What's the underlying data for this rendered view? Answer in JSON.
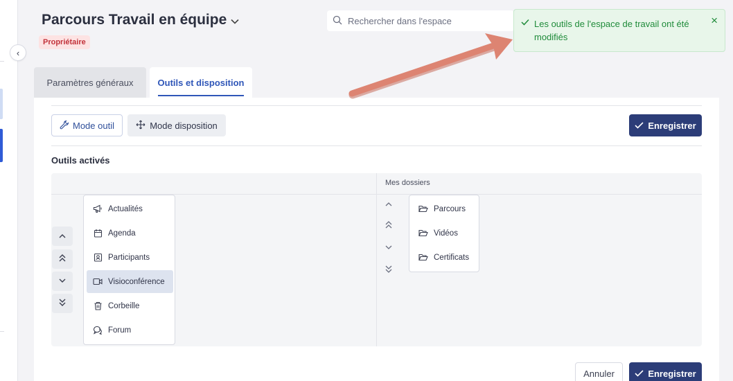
{
  "header": {
    "title": "Parcours Travail en équipe",
    "role_badge": "Propriétaire"
  },
  "search": {
    "placeholder": "Rechercher dans l'espace"
  },
  "toast": {
    "message": "Les outils de l'espace de travail ont été modifiés",
    "color": "#1f8b3a"
  },
  "tabs": [
    {
      "label": "Paramètres généraux",
      "active": false
    },
    {
      "label": "Outils et disposition",
      "active": true
    }
  ],
  "toolbar": {
    "mode_tool": "Mode outil",
    "mode_layout": "Mode disposition",
    "save": "Enregistrer"
  },
  "tools_section": {
    "title": "Outils activés",
    "folders_zone_label": "Mes dossiers",
    "tools": [
      {
        "label": "Actualités",
        "icon": "megaphone-icon"
      },
      {
        "label": "Agenda",
        "icon": "calendar-icon"
      },
      {
        "label": "Participants",
        "icon": "contacts-icon"
      },
      {
        "label": "Visioconférence",
        "icon": "video-icon",
        "selected": true
      },
      {
        "label": "Corbeille",
        "icon": "trash-icon"
      },
      {
        "label": "Forum",
        "icon": "chat-icon"
      }
    ],
    "folders": [
      {
        "label": "Parcours",
        "icon": "folder-icon"
      },
      {
        "label": "Vidéos",
        "icon": "folder-icon"
      },
      {
        "label": "Certificats",
        "icon": "folder-icon"
      }
    ]
  },
  "footer": {
    "cancel": "Annuler",
    "save": "Enregistrer"
  },
  "colors": {
    "primary": "#2c3d78",
    "accent": "#2f56b8",
    "badge_bg": "#fde3e3",
    "badge_text": "#c2323a",
    "annotation_arrow": "#d9806e"
  }
}
